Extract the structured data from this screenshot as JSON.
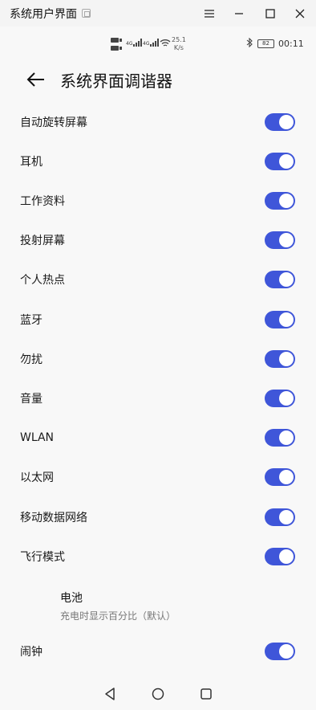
{
  "window": {
    "title": "系统用户界面"
  },
  "status": {
    "net1": "4G",
    "net2": "4G",
    "speed_value": "25.1",
    "speed_unit": "K/s",
    "battery": "82",
    "time": "00:11"
  },
  "header": {
    "title": "系统界面调谐器"
  },
  "toggles": [
    {
      "label": "自动旋转屏幕",
      "on": true
    },
    {
      "label": "耳机",
      "on": true
    },
    {
      "label": "工作资料",
      "on": true
    },
    {
      "label": "投射屏幕",
      "on": true
    },
    {
      "label": "个人热点",
      "on": true
    },
    {
      "label": "蓝牙",
      "on": true
    },
    {
      "label": "勿扰",
      "on": true
    },
    {
      "label": "音量",
      "on": true
    },
    {
      "label": "WLAN",
      "on": true
    },
    {
      "label": "以太网",
      "on": true
    },
    {
      "label": "移动数据网络",
      "on": true
    },
    {
      "label": "飞行模式",
      "on": true
    }
  ],
  "battery_option": {
    "title": "电池",
    "summary": "充电时显示百分比（默认）"
  },
  "alarm": {
    "label": "闹钟",
    "on": true
  },
  "colors": {
    "accent": "#3f56d9",
    "background": "#f8f8f8"
  }
}
